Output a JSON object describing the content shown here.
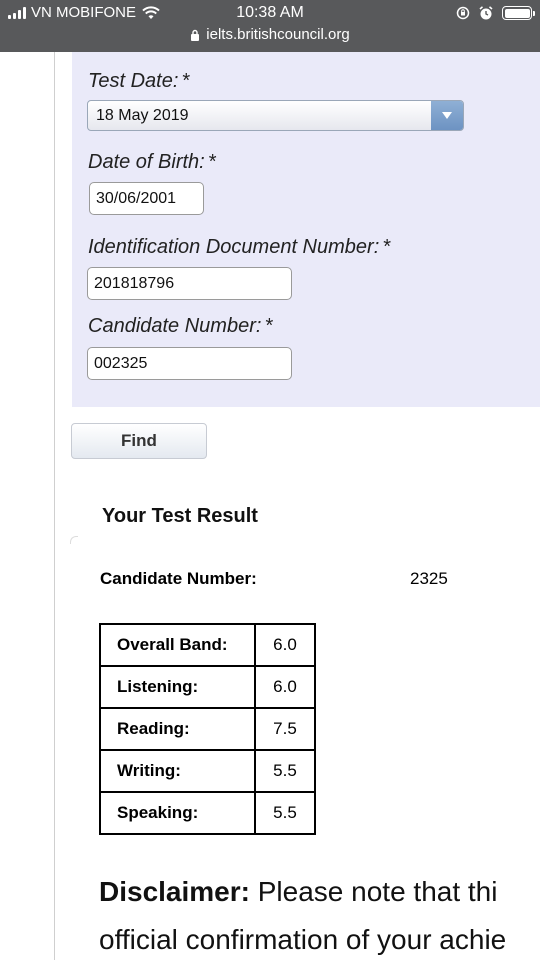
{
  "status_bar": {
    "carrier": "VN MOBIFONE",
    "time": "10:38 AM",
    "url": "ielts.britishcouncil.org"
  },
  "form": {
    "test_date": {
      "label": "Test Date:",
      "required": "*",
      "value": "18 May 2019"
    },
    "dob": {
      "label": "Date of Birth:",
      "required": "*",
      "value": "30/06/2001"
    },
    "id_number": {
      "label": "Identification Document Number:",
      "required": "*",
      "value": "201818796"
    },
    "candidate_number": {
      "label": "Candidate Number:",
      "required": "*",
      "value": "002325"
    },
    "find_label": "Find"
  },
  "result": {
    "title": "Your Test Result",
    "candidate_label": "Candidate Number:",
    "candidate_value": "2325",
    "scores": [
      {
        "label": "Overall Band:",
        "value": "6.0"
      },
      {
        "label": "Listening:",
        "value": "6.0"
      },
      {
        "label": "Reading:",
        "value": "7.5"
      },
      {
        "label": "Writing:",
        "value": "5.5"
      },
      {
        "label": "Speaking:",
        "value": "5.5"
      }
    ]
  },
  "disclaimer": {
    "heading": "Disclaimer:",
    "line1": "Please note that thi",
    "line2": "official confirmation of your achie"
  },
  "colors": {
    "status_bar_bg": "#58595b",
    "form_panel_bg": "#eaeaf9",
    "select_button": "#7aa0cc"
  }
}
